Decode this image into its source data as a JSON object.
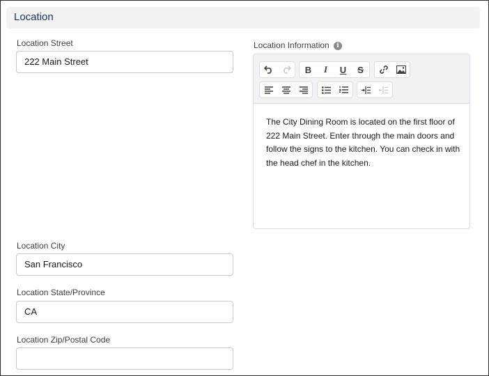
{
  "section": {
    "title": "Location"
  },
  "fields": {
    "street": {
      "label": "Location Street",
      "value": "222 Main Street"
    },
    "city": {
      "label": "Location City",
      "value": "San Francisco"
    },
    "state": {
      "label": "Location State/Province",
      "value": "CA"
    },
    "zip": {
      "label": "Location Zip/Postal Code",
      "value": ""
    }
  },
  "info": {
    "label": "Location Information",
    "info_icon_glyph": "i",
    "text": "The City Dining Room is located on the first floor of 222 Main Street. Enter through the main doors and follow the signs to the kitchen. You can check in with the head chef in the kitchen."
  },
  "toolbar": {
    "bold_glyph": "B",
    "italic_glyph": "I",
    "underline_glyph": "U",
    "strike_glyph": "S",
    "icons": [
      "undo-icon",
      "redo-icon",
      "bold-icon",
      "italic-icon",
      "underline-icon",
      "strikethrough-icon",
      "link-icon",
      "image-icon",
      "align-left-icon",
      "align-center-icon",
      "align-right-icon",
      "bullet-list-icon",
      "numbered-list-icon",
      "indent-icon",
      "outdent-icon"
    ]
  },
  "colors": {
    "section_title": "#16325c",
    "section_bg": "#f3f3f3",
    "input_border": "#c9c9c9",
    "label": "#3e3e3c"
  }
}
